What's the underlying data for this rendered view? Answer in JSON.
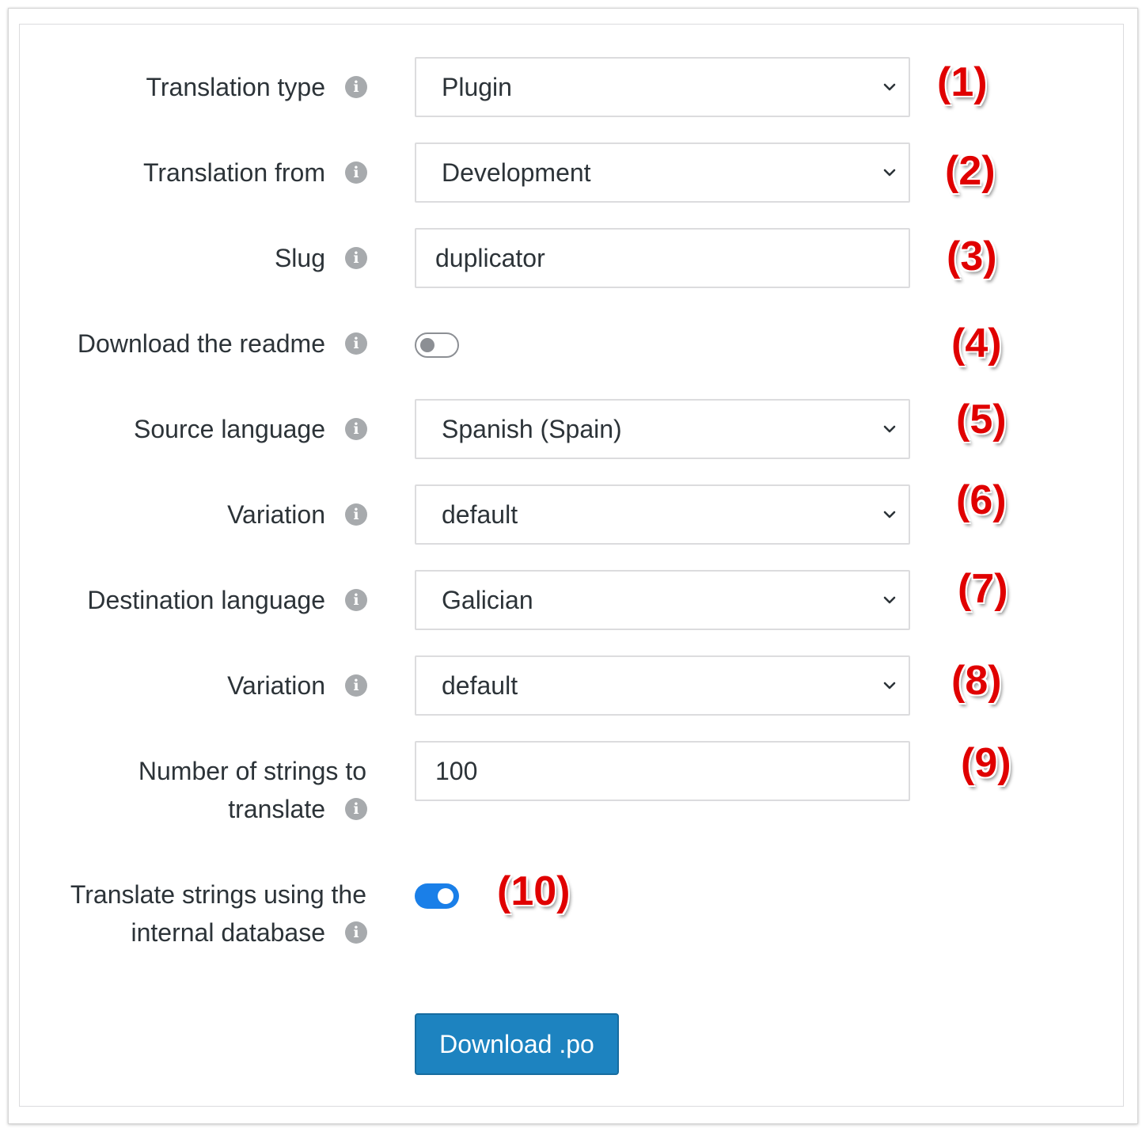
{
  "form": {
    "translation_type": {
      "label": "Translation type",
      "value": "Plugin",
      "marker": "(1)"
    },
    "translation_from": {
      "label": "Translation from",
      "value": "Development",
      "marker": "(2)"
    },
    "slug": {
      "label": "Slug",
      "value": "duplicator",
      "marker": "(3)"
    },
    "download_readme": {
      "label": "Download the readme",
      "enabled": false,
      "marker": "(4)"
    },
    "source_language": {
      "label": "Source language",
      "value": "Spanish (Spain)",
      "marker": "(5)"
    },
    "source_variation": {
      "label": "Variation",
      "value": "default",
      "marker": "(6)"
    },
    "destination_language": {
      "label": "Destination language",
      "value": "Galician",
      "marker": "(7)"
    },
    "destination_variation": {
      "label": "Variation",
      "value": "default",
      "marker": "(8)"
    },
    "strings_count": {
      "label_line1": "Number of strings to",
      "label_line2": "translate",
      "value": "100",
      "marker": "(9)"
    },
    "internal_database": {
      "label_line1": "Translate strings using the",
      "label_line2": "internal database",
      "enabled": true,
      "marker": "(10)"
    },
    "download_button": "Download .po"
  },
  "icons": {
    "info": "info-circle-icon",
    "chevron": "chevron-down-icon"
  },
  "colors": {
    "marker": "#e00000",
    "button": "#1d83c0",
    "toggle_on": "#1a7fe8",
    "info_icon": "#a7aaad"
  }
}
